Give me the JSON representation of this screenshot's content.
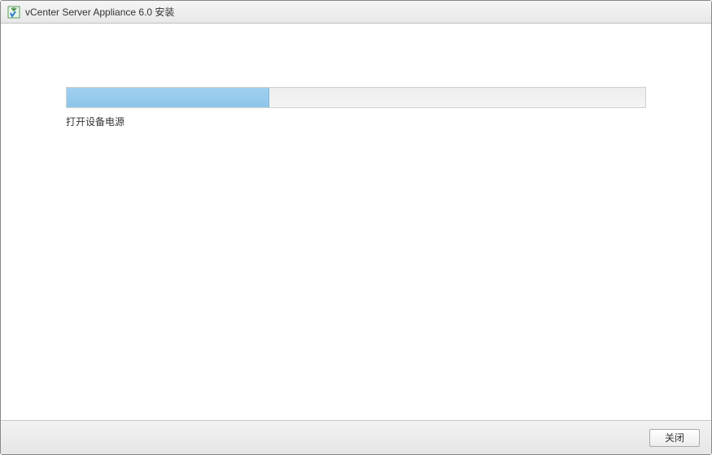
{
  "titlebar": {
    "title": "vCenter Server Appliance 6.0 安装"
  },
  "progress": {
    "percent": 35,
    "status_label": "打开设备电源"
  },
  "footer": {
    "close_label": "关闭"
  }
}
